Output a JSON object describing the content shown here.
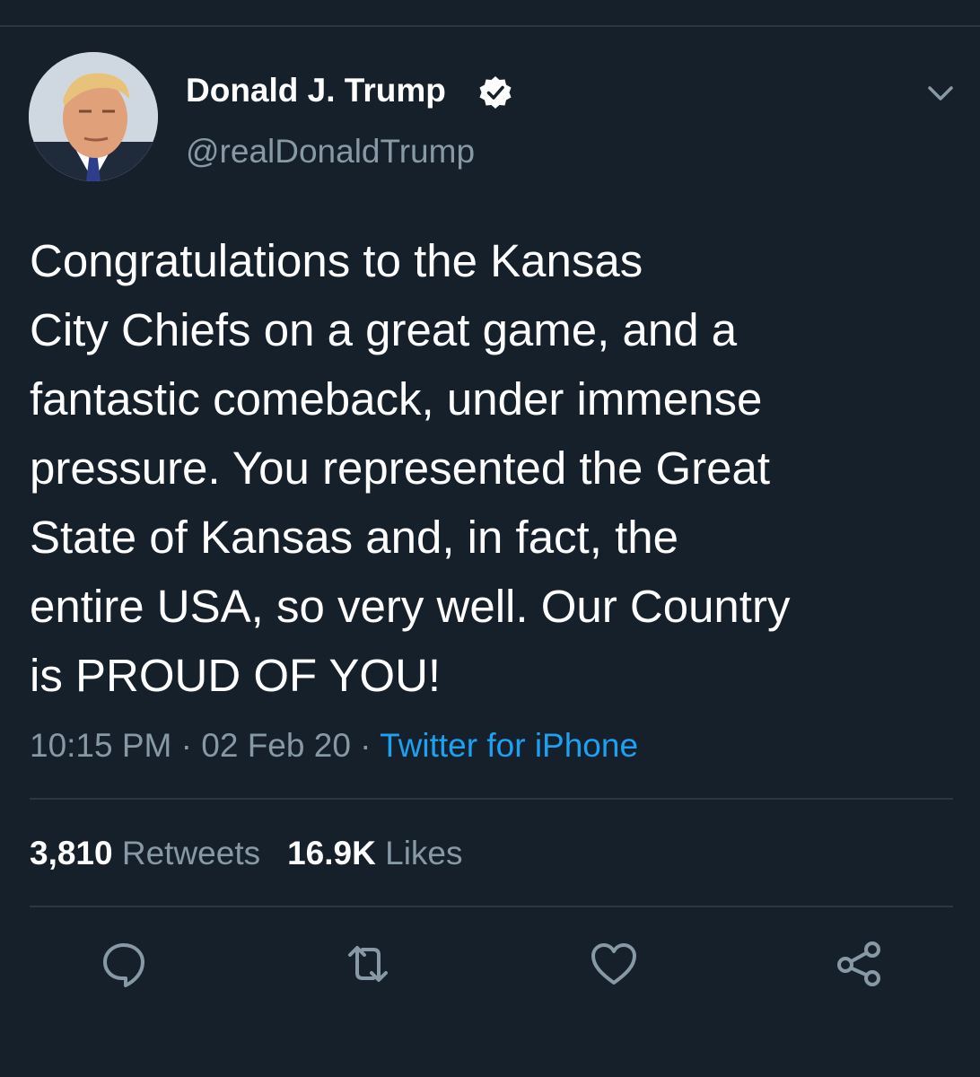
{
  "tweet": {
    "author": {
      "display_name": "Donald J. Trump",
      "handle": "@realDonaldTrump",
      "verified": true
    },
    "text": "Congratulations to the Kansas\nCity Chiefs on a great game, and a\nfantastic comeback, under immense\npressure. You represented the Great\nState of Kansas and, in fact, the\nentire USA, so very well. Our Country\nis PROUD OF YOU!",
    "time": "10:15 PM",
    "separator": " · ",
    "date": "02 Feb 20",
    "source": "Twitter for iPhone",
    "retweets": {
      "count": "3,810",
      "label": "Retweets"
    },
    "likes": {
      "count": "16.9K",
      "label": "Likes"
    }
  },
  "actions": [
    {
      "icon": "reply-icon"
    },
    {
      "icon": "retweet-icon"
    },
    {
      "icon": "like-icon"
    },
    {
      "icon": "share-icon"
    }
  ],
  "colors": {
    "background": "#15202b",
    "text": "#ffffff",
    "secondary": "#8899a6",
    "link": "#1da1f2",
    "divider": "#2a3642"
  }
}
